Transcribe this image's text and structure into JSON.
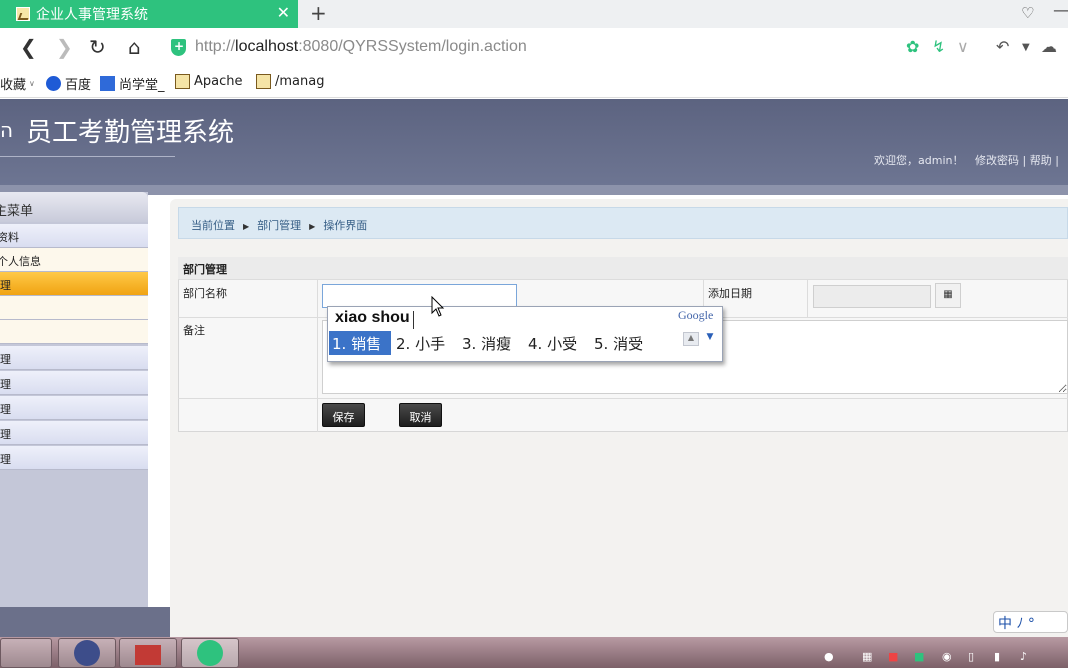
{
  "browser": {
    "tab_title": "企业人事管理系统",
    "tab_close": "✕",
    "new_tab": "+",
    "url_prefix": "http://",
    "url_host": "localhost",
    "url_rest": ":8080/QYRSSystem/login.action",
    "bookmarks": [
      "收藏",
      "百度",
      "尚学堂_",
      "Apache",
      "/manag"
    ]
  },
  "app": {
    "title": "员工考勤管理系统",
    "welcome": "欢迎您，admin！",
    "change_password": "修改密码",
    "help": "帮助",
    "separator": "|"
  },
  "sidebar": {
    "header": "主菜单",
    "items": [
      "资料",
      "个人信息",
      "理",
      "",
      "",
      "理",
      "理",
      "理",
      "理",
      "理"
    ]
  },
  "breadcrumb": [
    "当前位置",
    "部门管理",
    "操作界面"
  ],
  "form": {
    "section_title": "部门管理",
    "name_label": "部门名称",
    "name_value": "",
    "date_label": "添加日期",
    "date_value": "",
    "remark_label": "备注",
    "save_label": "保存",
    "cancel_label": "取消"
  },
  "ime": {
    "pinyin": "xiao shou",
    "brand": "Google",
    "candidates": [
      "1. 销售",
      "2. 小手",
      "3. 消瘦",
      "4. 小受",
      "5. 消受"
    ],
    "status": "中 ﾉ °"
  },
  "colors": {
    "header_bg": "#5c6380",
    "tab_green": "#2ec27e",
    "active_menu": "#f0a312",
    "candidate_highlight": "#3b73c8"
  }
}
